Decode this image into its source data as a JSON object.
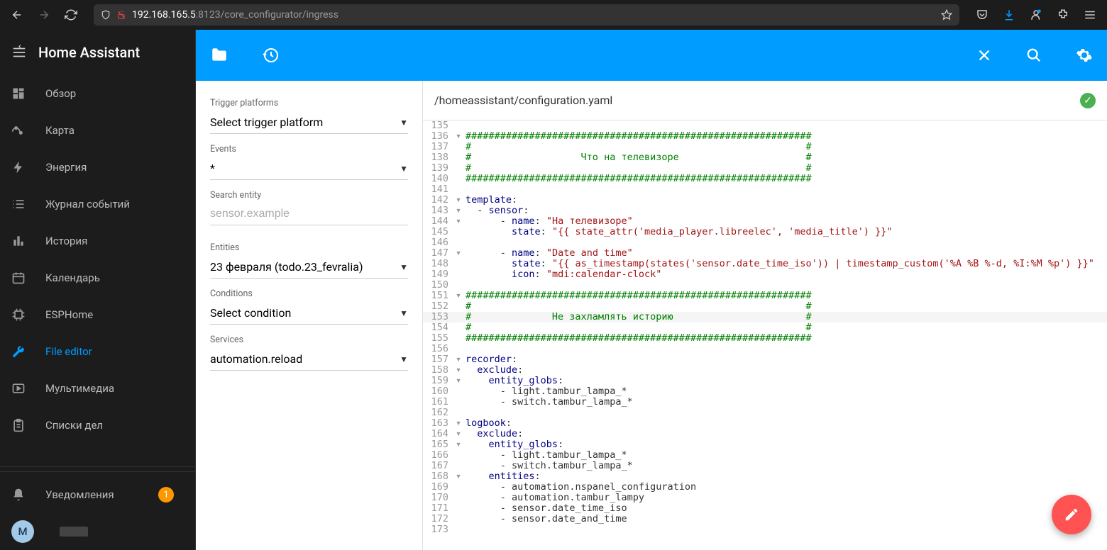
{
  "browser": {
    "url_host": "192.168.165.5",
    "url_port": ":8123",
    "url_path": "/core_configurator/ingress"
  },
  "sidebar": {
    "title": "Home Assistant",
    "items": [
      {
        "label": "Обзор",
        "icon": "dashboard"
      },
      {
        "label": "Карта",
        "icon": "map"
      },
      {
        "label": "Энергия",
        "icon": "bolt"
      },
      {
        "label": "Журнал событий",
        "icon": "list"
      },
      {
        "label": "История",
        "icon": "chart"
      },
      {
        "label": "Календарь",
        "icon": "calendar"
      },
      {
        "label": "ESPHome",
        "icon": "chip"
      },
      {
        "label": "File editor",
        "icon": "wrench",
        "active": true
      },
      {
        "label": "Мультимедиа",
        "icon": "play"
      },
      {
        "label": "Списки дел",
        "icon": "clipboard"
      }
    ],
    "notifications": {
      "label": "Уведомления",
      "count": "1"
    },
    "profile_initial": "M"
  },
  "panel": {
    "trigger_platforms_label": "Trigger platforms",
    "trigger_platforms_value": "Select trigger platform",
    "events_label": "Events",
    "events_value": "*",
    "search_entity_label": "Search entity",
    "search_entity_placeholder": "sensor.example",
    "entities_label": "Entities",
    "entities_value": "23 февраля (todo.23_fevralia)",
    "conditions_label": "Conditions",
    "conditions_value": "Select condition",
    "services_label": "Services",
    "services_value": "automation.reload"
  },
  "editor": {
    "path": "/homeassistant/configuration.yaml",
    "lines": [
      {
        "n": 135,
        "code": ""
      },
      {
        "n": 136,
        "fold": "▾",
        "code": "<span class='c-green'>############################################################</span>"
      },
      {
        "n": 137,
        "code": "<span class='c-green'>#                                                          #</span>"
      },
      {
        "n": 138,
        "code": "<span class='c-green'>#                   Что на телевизоре                      #</span>"
      },
      {
        "n": 139,
        "code": "<span class='c-green'>#                                                          #</span>"
      },
      {
        "n": 140,
        "code": "<span class='c-green'>############################################################</span>"
      },
      {
        "n": 141,
        "code": ""
      },
      {
        "n": 142,
        "fold": "▾",
        "code": "<span class='c-blue'>template</span><span class='c-black'>:</span>"
      },
      {
        "n": 143,
        "fold": "▾",
        "code": "  <span class='c-black'>- </span><span class='c-blue'>sensor</span><span class='c-black'>:</span>"
      },
      {
        "n": 144,
        "fold": "▾",
        "code": "      <span class='c-black'>- </span><span class='c-blue'>name</span><span class='c-black'>: </span><span class='c-brown'>\"На телевизоре\"</span>"
      },
      {
        "n": 145,
        "code": "        <span class='c-blue'>state</span><span class='c-black'>: </span><span class='c-brown'>\"{{ state_attr('media_player.libreelec', 'media_title') }}\"</span>"
      },
      {
        "n": 146,
        "code": ""
      },
      {
        "n": 147,
        "fold": "▾",
        "code": "      <span class='c-black'>- </span><span class='c-blue'>name</span><span class='c-black'>: </span><span class='c-brown'>\"Date and time\"</span>"
      },
      {
        "n": 148,
        "code": "        <span class='c-blue'>state</span><span class='c-black'>: </span><span class='c-brown'>\"{{ as_timestamp(states('sensor.date_time_iso')) | timestamp_custom('%A %B %-d, %I:%M %p') }}\"</span>"
      },
      {
        "n": 149,
        "code": "        <span class='c-blue'>icon</span><span class='c-black'>: </span><span class='c-brown'>\"mdi:calendar-clock\"</span>"
      },
      {
        "n": 150,
        "code": ""
      },
      {
        "n": 151,
        "fold": "▾",
        "code": "<span class='c-green'>############################################################</span>"
      },
      {
        "n": 152,
        "code": "<span class='c-green'>#                                                          #</span>"
      },
      {
        "n": 153,
        "hl": true,
        "code": "<span class='c-green'>#              Не захламлять историю                       #</span>"
      },
      {
        "n": 154,
        "code": "<span class='c-green'>#                                                          #</span>"
      },
      {
        "n": 155,
        "code": "<span class='c-green'>############################################################</span>"
      },
      {
        "n": 156,
        "code": ""
      },
      {
        "n": 157,
        "fold": "▾",
        "code": "<span class='c-blue'>recorder</span><span class='c-black'>:</span>"
      },
      {
        "n": 158,
        "fold": "▾",
        "code": "  <span class='c-blue'>exclude</span><span class='c-black'>:</span>"
      },
      {
        "n": 159,
        "fold": "▾",
        "code": "    <span class='c-blue'>entity_globs</span><span class='c-black'>:</span>"
      },
      {
        "n": 160,
        "code": "      <span class='c-black'>- light.tambur_lampa_*</span>"
      },
      {
        "n": 161,
        "code": "      <span class='c-black'>- switch.tambur_lampa_*</span>"
      },
      {
        "n": 162,
        "code": ""
      },
      {
        "n": 163,
        "fold": "▾",
        "code": "<span class='c-blue'>logbook</span><span class='c-black'>:</span>"
      },
      {
        "n": 164,
        "fold": "▾",
        "code": "  <span class='c-blue'>exclude</span><span class='c-black'>:</span>"
      },
      {
        "n": 165,
        "fold": "▾",
        "code": "    <span class='c-blue'>entity_globs</span><span class='c-black'>:</span>"
      },
      {
        "n": 166,
        "code": "      <span class='c-black'>- light.tambur_lampa_*</span>"
      },
      {
        "n": 167,
        "code": "      <span class='c-black'>- switch.tambur_lampa_*</span>"
      },
      {
        "n": 168,
        "fold": "▾",
        "code": "    <span class='c-blue'>entities</span><span class='c-black'>:</span>"
      },
      {
        "n": 169,
        "code": "      <span class='c-black'>- automation.nspanel_configuration</span>"
      },
      {
        "n": 170,
        "code": "      <span class='c-black'>- automation.tambur_lampy</span>"
      },
      {
        "n": 171,
        "code": "      <span class='c-black'>- sensor.date_time_iso</span>"
      },
      {
        "n": 172,
        "code": "      <span class='c-black'>- sensor.date_and_time</span>"
      },
      {
        "n": 173,
        "code": ""
      }
    ]
  }
}
